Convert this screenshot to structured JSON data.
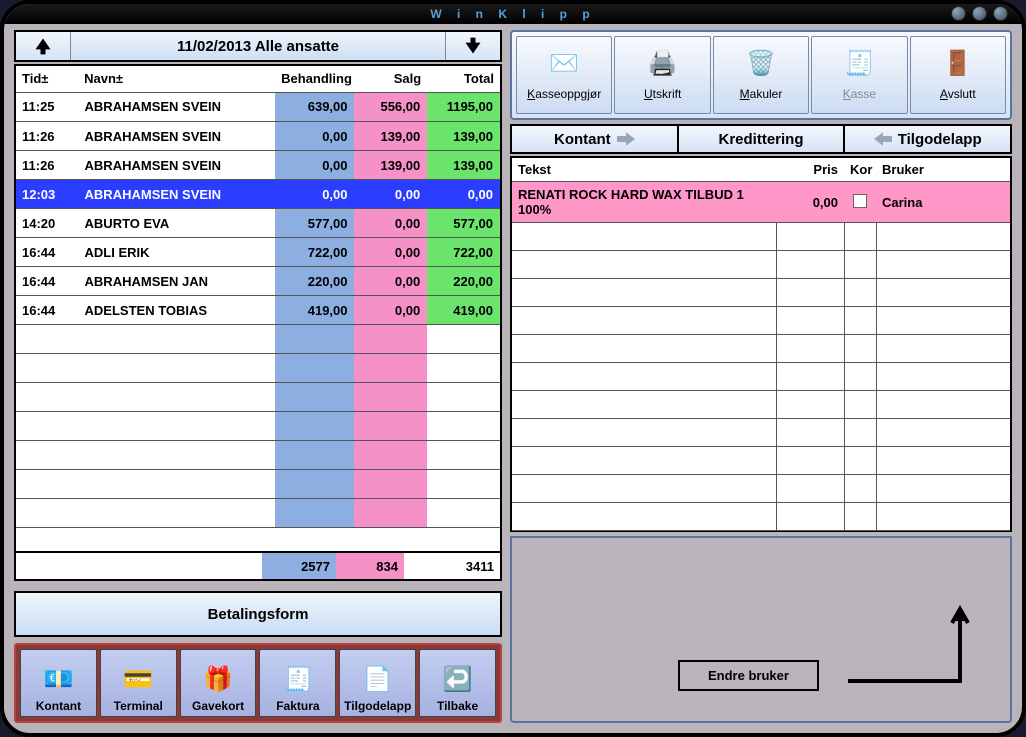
{
  "app_title": "W i n K l i p p",
  "left": {
    "date_title": "11/02/2013 Alle ansatte",
    "columns": {
      "tid": "Tid±",
      "navn": "Navn±",
      "beh": "Behandling",
      "salg": "Salg",
      "tot": "Total"
    },
    "rows": [
      {
        "tid": "11:25",
        "navn": "ABRAHAMSEN SVEIN",
        "beh": "639,00",
        "salg": "556,00",
        "tot": "1195,00",
        "selected": false
      },
      {
        "tid": "11:26",
        "navn": "ABRAHAMSEN SVEIN",
        "beh": "0,00",
        "salg": "139,00",
        "tot": "139,00",
        "selected": false
      },
      {
        "tid": "11:26",
        "navn": "ABRAHAMSEN SVEIN",
        "beh": "0,00",
        "salg": "139,00",
        "tot": "139,00",
        "selected": false
      },
      {
        "tid": "12:03",
        "navn": "ABRAHAMSEN SVEIN",
        "beh": "0,00",
        "salg": "0,00",
        "tot": "0,00",
        "selected": true
      },
      {
        "tid": "14:20",
        "navn": "ABURTO EVA",
        "beh": "577,00",
        "salg": "0,00",
        "tot": "577,00",
        "selected": false
      },
      {
        "tid": "16:44",
        "navn": "ADLI ERIK",
        "beh": "722,00",
        "salg": "0,00",
        "tot": "722,00",
        "selected": false
      },
      {
        "tid": "16:44",
        "navn": "ABRAHAMSEN JAN",
        "beh": "220,00",
        "salg": "0,00",
        "tot": "220,00",
        "selected": false
      },
      {
        "tid": "16:44",
        "navn": "ADELSTEN TOBIAS",
        "beh": "419,00",
        "salg": "0,00",
        "tot": "419,00",
        "selected": false
      }
    ],
    "empty_rows": 7,
    "totals": {
      "beh": "2577",
      "salg": "834",
      "tot": "3411"
    },
    "betalings_label": "Betalingsform",
    "pay_buttons": [
      {
        "key": "kontant",
        "label": "Kontant",
        "icon": "💶"
      },
      {
        "key": "terminal",
        "label": "Terminal",
        "icon": "💳"
      },
      {
        "key": "gavekort",
        "label": "Gavekort",
        "icon": "🎁"
      },
      {
        "key": "faktura",
        "label": "Faktura",
        "icon": "🧾"
      },
      {
        "key": "tilgode",
        "label": "Tilgodelapp",
        "icon": "📄"
      },
      {
        "key": "tilbake",
        "label": "Tilbake",
        "icon": "↩️"
      }
    ]
  },
  "right": {
    "tools": [
      {
        "key": "kasseoppgjor",
        "label": "Kasseoppgjør",
        "icon": "✉️",
        "disabled": false
      },
      {
        "key": "utskrift",
        "label": "Utskrift",
        "icon": "🖨️",
        "disabled": false
      },
      {
        "key": "makuler",
        "label": "Makuler",
        "icon": "🗑️",
        "disabled": false
      },
      {
        "key": "kasse",
        "label": "Kasse",
        "icon": "🧾",
        "disabled": true
      },
      {
        "key": "avslutt",
        "label": "Avslutt",
        "icon": "🚪",
        "disabled": false
      }
    ],
    "tabs": {
      "kontant": "Kontant",
      "kreditt": "Kredittering",
      "tilgode": "Tilgodelapp"
    },
    "line_cols": {
      "tekst": "Tekst",
      "pris": "Pris",
      "kor": "Kor",
      "bruker": "Bruker"
    },
    "lines": [
      {
        "tekst": "RENATI ROCK HARD WAX TILBUD 1 100%",
        "pris": "0,00",
        "kor": false,
        "bruker": "Carina",
        "pink": true
      }
    ],
    "empty_lines": 11,
    "annotation": "Endre bruker"
  }
}
